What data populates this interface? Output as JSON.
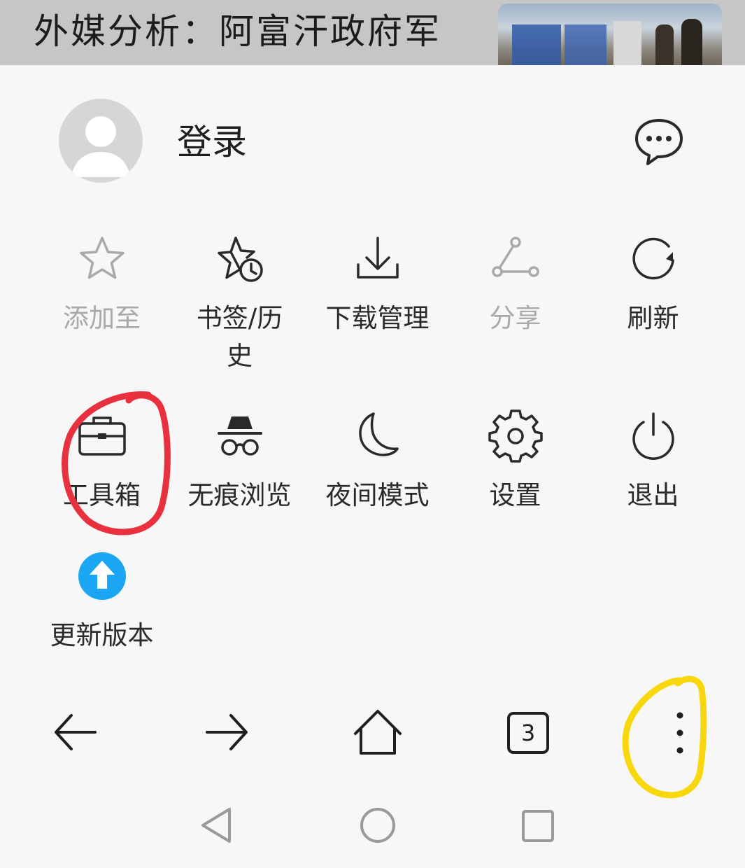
{
  "news": {
    "headline": "外媒分析：阿富汗政府军"
  },
  "account": {
    "login_label": "登录"
  },
  "menu_items": [
    {
      "label": "添加至",
      "icon": "star-icon",
      "enabled": false
    },
    {
      "label": "书签/历史",
      "icon": "bookmark-history-icon",
      "enabled": true
    },
    {
      "label": "下载管理",
      "icon": "download-icon",
      "enabled": true
    },
    {
      "label": "分享",
      "icon": "share-icon",
      "enabled": false
    },
    {
      "label": "刷新",
      "icon": "refresh-icon",
      "enabled": true
    },
    {
      "label": "工具箱",
      "icon": "toolbox-icon",
      "enabled": true
    },
    {
      "label": "无痕浏览",
      "icon": "incognito-icon",
      "enabled": true
    },
    {
      "label": "夜间模式",
      "icon": "moon-icon",
      "enabled": true
    },
    {
      "label": "设置",
      "icon": "gear-icon",
      "enabled": true
    },
    {
      "label": "退出",
      "icon": "power-icon",
      "enabled": true
    },
    {
      "label": "更新版本",
      "icon": "update-arrow-icon",
      "enabled": true
    }
  ],
  "toolbar": {
    "tab_count": "3"
  },
  "colors": {
    "background": "#f7f7f7",
    "update_blue": "#1aa6f2",
    "annotation_red": "#e8303e",
    "annotation_yellow": "#f8d80c"
  }
}
